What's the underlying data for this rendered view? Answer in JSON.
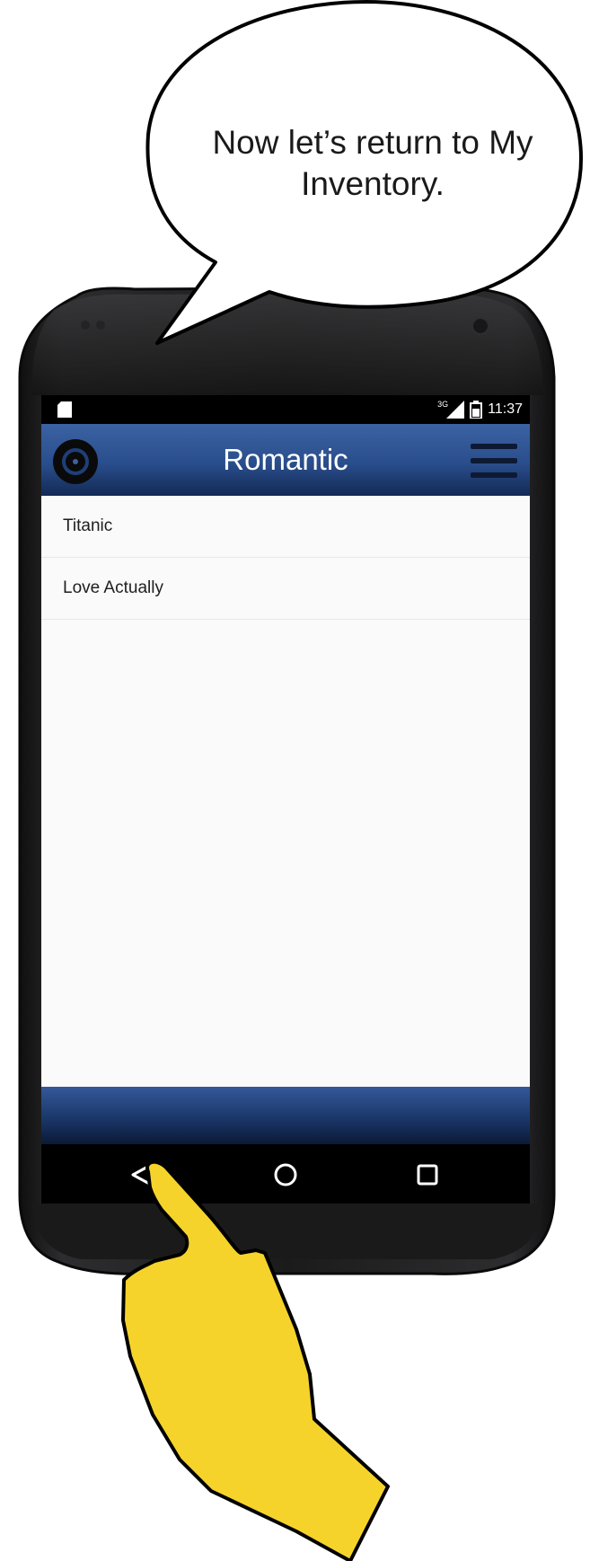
{
  "speech_bubble": {
    "text": "Now let’s return to My Inventory."
  },
  "status_bar": {
    "time": "11:37",
    "network": "3G",
    "icons": [
      "sd-card-icon",
      "signal-icon",
      "battery-icon"
    ]
  },
  "app_bar": {
    "title": "Romantic",
    "logo_icon": "disc-icon",
    "menu_icon": "hamburger-menu-icon"
  },
  "list": {
    "items": [
      {
        "label": "Titanic"
      },
      {
        "label": "Love Actually"
      }
    ]
  },
  "nav_bar": {
    "icons": [
      "back-icon",
      "home-icon",
      "recents-icon"
    ]
  },
  "colors": {
    "app_bar_blue": "#2a4e8c",
    "pointer_hand": "#f5d32b",
    "phone_body": "#1c1c1e"
  }
}
